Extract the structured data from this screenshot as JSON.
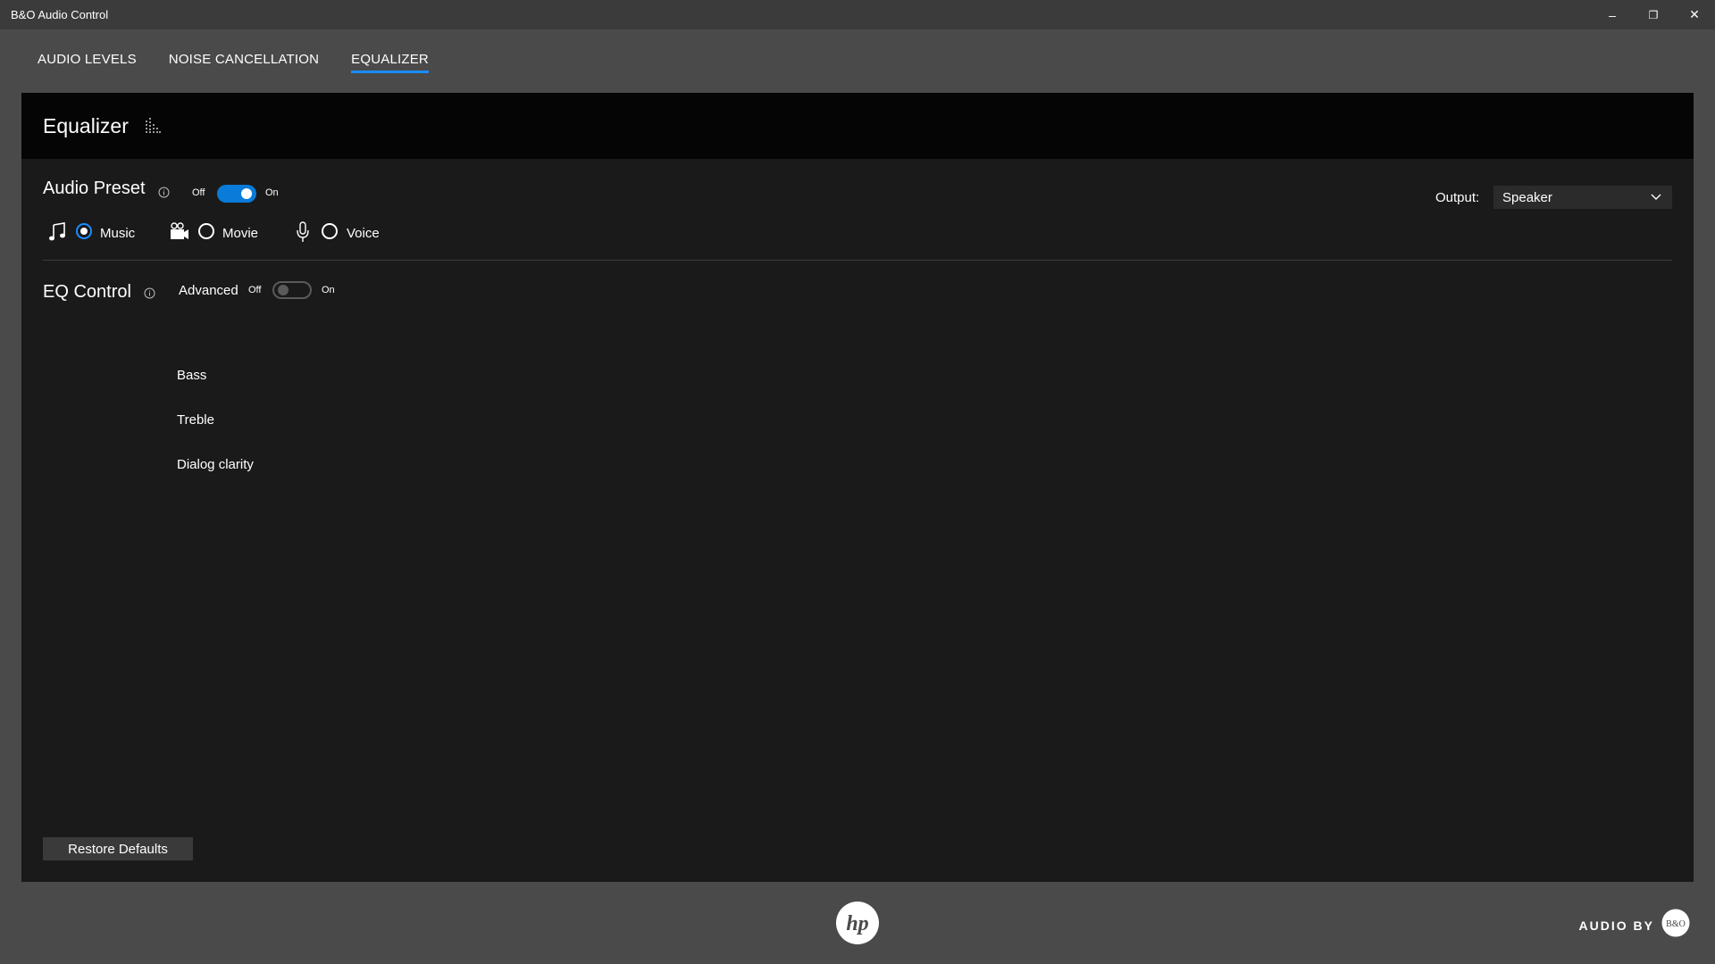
{
  "window": {
    "title": "B&O Audio Control",
    "minimize": "–",
    "restore": "❐",
    "close": "✕"
  },
  "tabs": [
    {
      "label": "AUDIO LEVELS",
      "active": false
    },
    {
      "label": "NOISE CANCELLATION",
      "active": false
    },
    {
      "label": "EQUALIZER",
      "active": true
    }
  ],
  "panel": {
    "title": "Equalizer",
    "icon": "equalizer-bars-icon"
  },
  "audio_preset": {
    "title": "Audio Preset",
    "toggle_off_label": "Off",
    "toggle_on_label": "On",
    "enabled": true,
    "options": [
      {
        "label": "Music",
        "icon": "music-note-icon",
        "checked": true
      },
      {
        "label": "Movie",
        "icon": "movie-camera-icon",
        "checked": false
      },
      {
        "label": "Voice",
        "icon": "microphone-icon",
        "checked": false
      }
    ]
  },
  "output": {
    "label": "Output:",
    "selected": "Speaker"
  },
  "eq_control": {
    "title": "EQ Control",
    "advanced_label": "Advanced",
    "toggle_off_label": "Off",
    "toggle_on_label": "On",
    "advanced_enabled": false,
    "rows": [
      {
        "label": "Bass"
      },
      {
        "label": "Treble"
      },
      {
        "label": "Dialog clarity"
      }
    ]
  },
  "restore_button": {
    "label": "Restore Defaults"
  },
  "footer": {
    "audio_by": "AUDIO BY",
    "hp_logo_text": "hp",
    "bo_logo_text": "B&O"
  },
  "colors": {
    "accent": "#1a8cff",
    "toggle_on": "#0a7bd8",
    "background": "#4a4a4a",
    "panel": "#1a1a1a",
    "panel_header": "#050505"
  }
}
